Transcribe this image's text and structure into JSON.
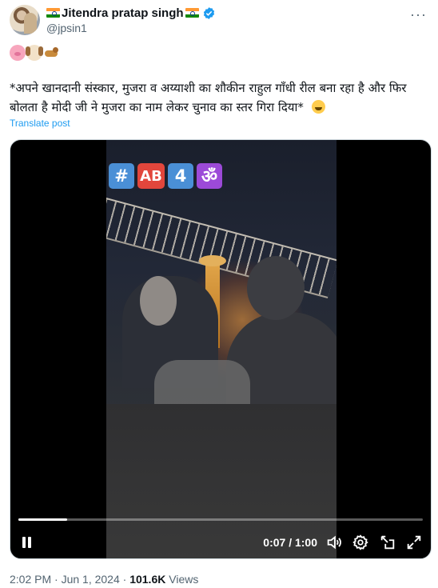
{
  "author": {
    "display_name": "Jitendra pratap singh",
    "handle": "@jpsin1"
  },
  "post": {
    "emojis": [
      "pig-face",
      "dog-face",
      "guide-dog"
    ],
    "text": "*अपने खानदानी संस्कार, मुजरा व अय्याशी का शौकीन राहुल गाँधी रील बना रहा है और फिर बोलता है मोदी जी ने मुजरा का नाम लेकर चुनाव का स्तर गिरा दिया*",
    "translate_label": "Translate post"
  },
  "video": {
    "overlay_tags": [
      "#",
      "AB",
      "4",
      "ॐ"
    ],
    "time_display": "0:07 / 1:00",
    "progress_fraction": 0.12
  },
  "footer": {
    "timestamp": "2:02 PM · Jun 1, 2024 · ",
    "views_count": "101.6K",
    "views_label": " Views"
  },
  "colors": {
    "link": "#1d9bf0",
    "verified": "#1d9bf0",
    "muted": "#536471"
  }
}
